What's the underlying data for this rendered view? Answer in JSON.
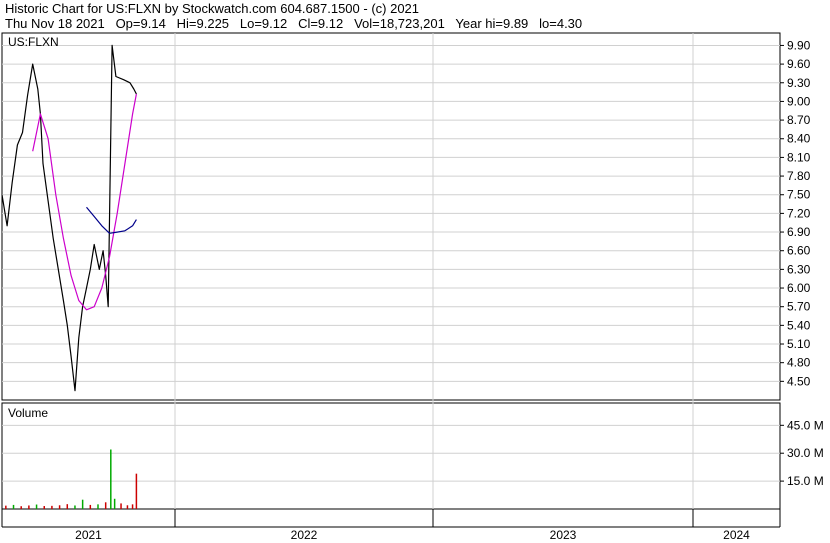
{
  "header": {
    "line1": "Historic Chart for US:FLXN by Stockwatch.com 604.687.1500 - (c) 2021",
    "line2": "Thu Nov 18 2021   Op=9.14   Hi=9.225   Lo=9.12   Cl=9.12   Vol=18,723,201   Year hi=9.89   lo=4.30"
  },
  "chart_data": {
    "type": "line",
    "symbol": "US:FLXN",
    "volume_label": "Volume",
    "price_ticks": [
      "9.90",
      "9.60",
      "9.30",
      "9.00",
      "8.70",
      "8.40",
      "8.10",
      "7.80",
      "7.50",
      "7.20",
      "6.90",
      "6.60",
      "6.30",
      "6.00",
      "5.70",
      "5.40",
      "5.10",
      "4.80",
      "4.50"
    ],
    "volume_ticks": [
      "45.0 M",
      "30.0 M",
      "15.0 M"
    ],
    "x_labels": [
      "2021",
      "2022",
      "2023",
      "2024"
    ],
    "ylim_price": [
      4.2,
      10.1
    ],
    "ylim_volume_millions": [
      0,
      57
    ],
    "year_hi": 9.89,
    "year_lo": 4.3,
    "series": [
      {
        "color": "#000000",
        "points": [
          [
            0.0,
            7.5
          ],
          [
            0.4,
            7.0
          ],
          [
            0.8,
            7.7
          ],
          [
            1.2,
            8.3
          ],
          [
            1.6,
            8.5
          ],
          [
            2.0,
            9.1
          ],
          [
            2.4,
            9.6
          ],
          [
            2.8,
            9.2
          ],
          [
            3.0,
            8.8
          ],
          [
            3.2,
            8.0
          ],
          [
            3.6,
            7.4
          ],
          [
            4.0,
            6.8
          ],
          [
            4.4,
            6.3
          ],
          [
            4.8,
            5.8
          ],
          [
            5.1,
            5.4
          ],
          [
            5.4,
            4.9
          ],
          [
            5.7,
            4.35
          ],
          [
            6.0,
            5.2
          ],
          [
            6.3,
            5.7
          ],
          [
            6.6,
            6.0
          ],
          [
            6.9,
            6.3
          ],
          [
            7.2,
            6.7
          ],
          [
            7.6,
            6.3
          ],
          [
            7.9,
            6.6
          ],
          [
            8.1,
            6.2
          ],
          [
            8.3,
            5.7
          ],
          [
            8.6,
            9.9
          ],
          [
            8.9,
            9.4
          ],
          [
            9.5,
            9.35
          ],
          [
            10.0,
            9.3
          ],
          [
            10.3,
            9.2
          ],
          [
            10.5,
            9.12
          ]
        ]
      },
      {
        "color": "#cc00cc",
        "points": [
          [
            2.4,
            8.2
          ],
          [
            3.0,
            8.8
          ],
          [
            3.6,
            8.4
          ],
          [
            4.2,
            7.5
          ],
          [
            4.8,
            6.8
          ],
          [
            5.4,
            6.2
          ],
          [
            6.0,
            5.8
          ],
          [
            6.6,
            5.65
          ],
          [
            7.2,
            5.7
          ],
          [
            7.8,
            6.0
          ],
          [
            8.4,
            6.5
          ],
          [
            9.0,
            7.2
          ],
          [
            9.6,
            8.0
          ],
          [
            10.2,
            8.8
          ],
          [
            10.5,
            9.12
          ]
        ]
      },
      {
        "color": "#00008b",
        "points": [
          [
            6.6,
            7.3
          ],
          [
            7.2,
            7.15
          ],
          [
            7.8,
            7.0
          ],
          [
            8.4,
            6.88
          ],
          [
            9.0,
            6.9
          ],
          [
            9.6,
            6.92
          ],
          [
            10.2,
            7.0
          ],
          [
            10.5,
            7.1
          ]
        ]
      }
    ],
    "volume_bars": [
      {
        "x": 0.3,
        "v": 1.8,
        "color": "#cc0000"
      },
      {
        "x": 0.9,
        "v": 2.2,
        "color": "#00aa00"
      },
      {
        "x": 1.5,
        "v": 1.5,
        "color": "#cc0000"
      },
      {
        "x": 2.1,
        "v": 1.9,
        "color": "#cc0000"
      },
      {
        "x": 2.7,
        "v": 2.4,
        "color": "#00aa00"
      },
      {
        "x": 3.3,
        "v": 1.6,
        "color": "#cc0000"
      },
      {
        "x": 3.9,
        "v": 1.7,
        "color": "#cc0000"
      },
      {
        "x": 4.5,
        "v": 2.0,
        "color": "#cc0000"
      },
      {
        "x": 5.1,
        "v": 2.6,
        "color": "#cc0000"
      },
      {
        "x": 5.7,
        "v": 1.9,
        "color": "#00aa00"
      },
      {
        "x": 6.3,
        "v": 5.0,
        "color": "#00aa00"
      },
      {
        "x": 6.9,
        "v": 2.2,
        "color": "#cc0000"
      },
      {
        "x": 7.5,
        "v": 2.5,
        "color": "#00aa00"
      },
      {
        "x": 8.1,
        "v": 3.6,
        "color": "#cc0000"
      },
      {
        "x": 8.5,
        "v": 32.0,
        "color": "#00aa00"
      },
      {
        "x": 8.8,
        "v": 5.5,
        "color": "#00aa00"
      },
      {
        "x": 9.3,
        "v": 3.0,
        "color": "#cc0000"
      },
      {
        "x": 9.8,
        "v": 2.0,
        "color": "#cc0000"
      },
      {
        "x": 10.2,
        "v": 2.5,
        "color": "#cc0000"
      },
      {
        "x": 10.5,
        "v": 19.0,
        "color": "#cc0000"
      }
    ],
    "colors": {
      "price": "#000000",
      "ma_long": "#cc00cc",
      "ma_short": "#00008b",
      "vol_up": "#00aa00",
      "vol_down": "#cc0000",
      "grid": "#d0d0d0"
    },
    "grid": true
  }
}
